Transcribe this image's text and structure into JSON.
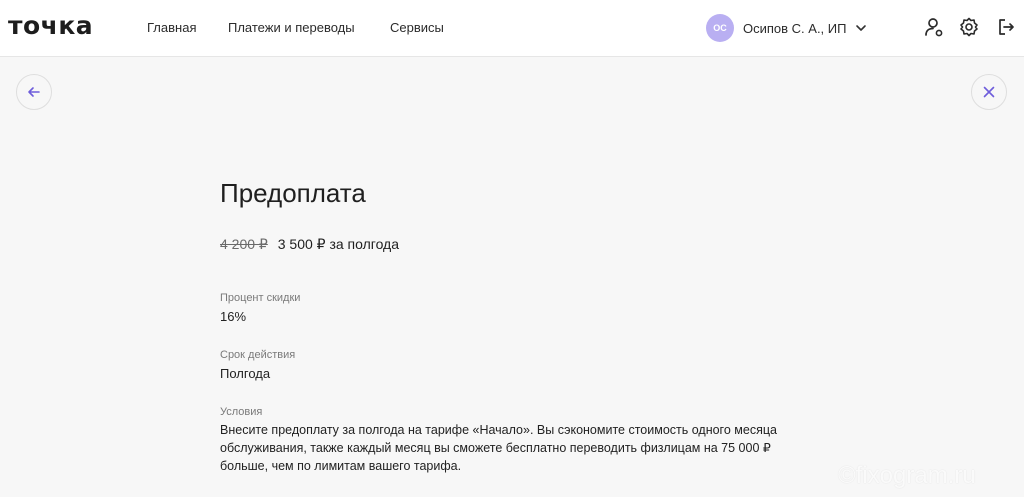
{
  "header": {
    "logo": "точка",
    "nav": [
      {
        "label": "Главная"
      },
      {
        "label": "Платежи и переводы"
      },
      {
        "label": "Сервисы"
      }
    ],
    "user": {
      "initials": "ОС",
      "name": "Осипов С. А., ИП",
      "avatar_color": "#b9aff2"
    },
    "icons": [
      "user-gear-icon",
      "settings-gear-icon",
      "logout-icon"
    ]
  },
  "controls": {
    "back_icon": "arrow-left-icon",
    "close_icon": "close-icon",
    "accent_color": "#6e5ddb"
  },
  "offer": {
    "title": "Предоплата",
    "old_price": "4 200 ₽",
    "new_price": "3 500 ₽ за полгода",
    "discount_label": "Процент скидки",
    "discount_value": "16%",
    "term_label": "Срок действия",
    "term_value": "Полгода",
    "conditions_label": "Условия",
    "conditions_text": "Внесите предоплату за полгода на тарифе «Начало». Вы сэкономите стоимость одного месяца обслуживания, также каждый месяц вы сможете бесплатно переводить физлицам на 75 000 ₽ больше, чем по лимитам вашего тарифа."
  },
  "watermark": "©fixogram.ru"
}
